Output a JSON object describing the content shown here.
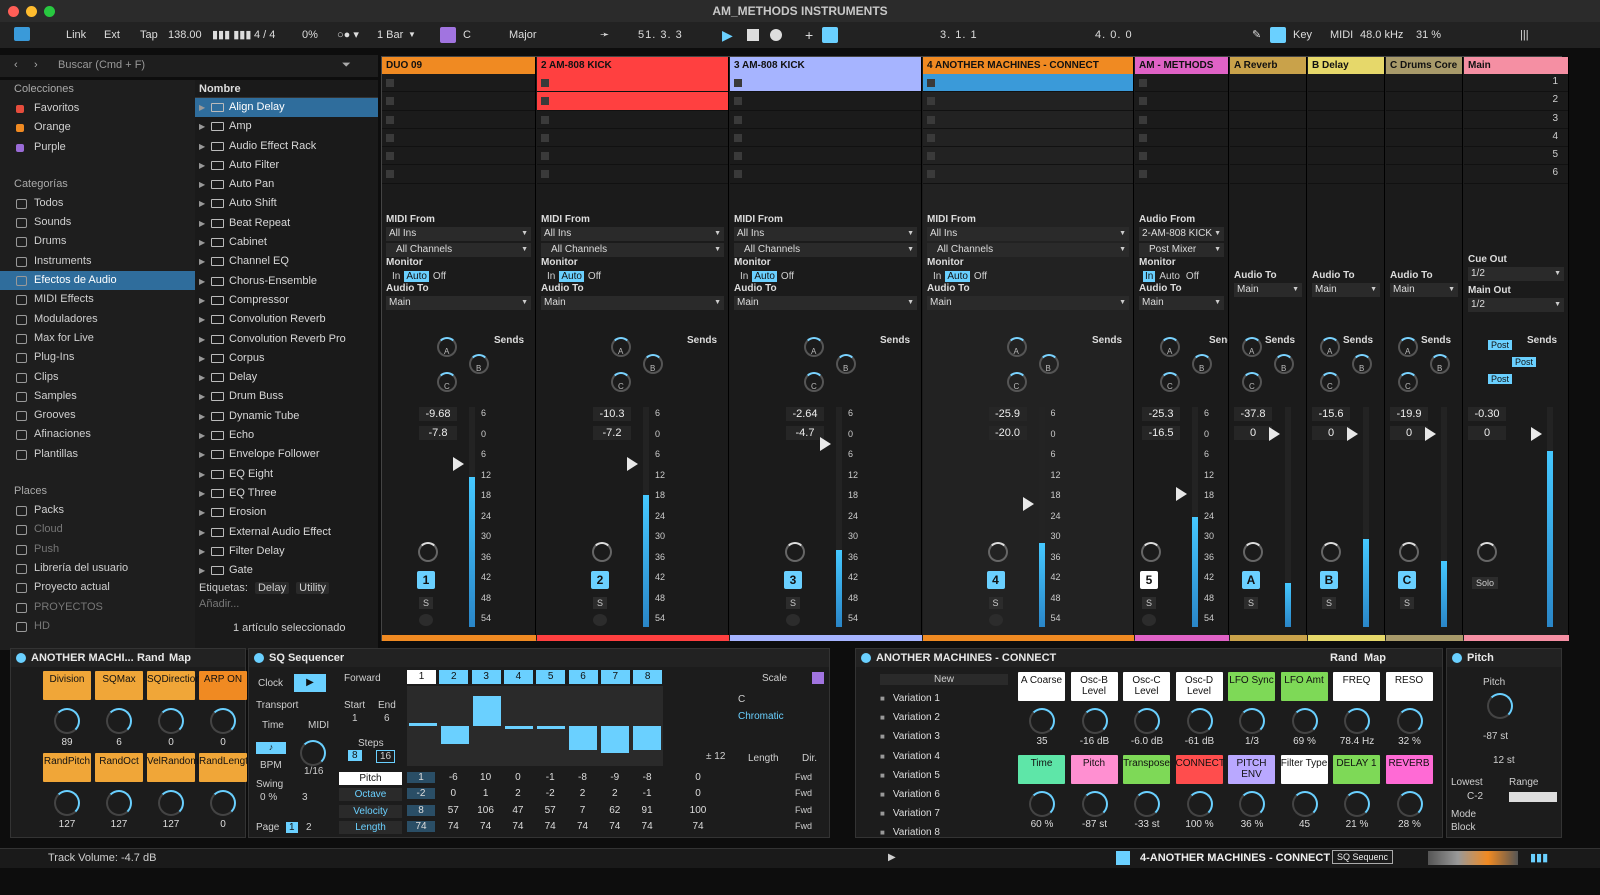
{
  "window": {
    "title": "AM_METHODS INSTRUMENTS"
  },
  "toolbar": {
    "link": "Link",
    "ext": "Ext",
    "tap": "Tap",
    "tempo": "138.00",
    "meter": "4 / 4",
    "swing_pct": "0%",
    "quantize": "1 Bar",
    "key_root": "C",
    "scale": "Major",
    "position": "51. 3. 3",
    "loop_start": "3. 1. 1",
    "loop_len": "4. 0. 0",
    "key": "Key",
    "midi": "MIDI",
    "sample_rate": "48.0 kHz",
    "cpu": "31 %"
  },
  "browser": {
    "search_placeholder": "Buscar (Cmd + F)",
    "collections_title": "Colecciones",
    "collections": [
      "Favoritos",
      "Orange",
      "Purple"
    ],
    "collection_colors": [
      "#e64d3d",
      "#f08a22",
      "#9a6bd6"
    ],
    "categories_title": "Categorías",
    "categories": [
      "Todos",
      "Sounds",
      "Drums",
      "Instruments",
      "Efectos de Audio",
      "MIDI Effects",
      "Moduladores",
      "Max for Live",
      "Plug-Ins",
      "Clips",
      "Samples",
      "Grooves",
      "Afinaciones",
      "Plantillas"
    ],
    "places_title": "Places",
    "places": [
      "Packs",
      "Cloud",
      "Push",
      "Librería del usuario",
      "Proyecto actual",
      "PROYECTOS",
      "HD"
    ],
    "list_header": "Nombre",
    "items": [
      "Align Delay",
      "Amp",
      "Audio Effect Rack",
      "Auto Filter",
      "Auto Pan",
      "Auto Shift",
      "Beat Repeat",
      "Cabinet",
      "Channel EQ",
      "Chorus-Ensemble",
      "Compressor",
      "Convolution Reverb",
      "Convolution Reverb Pro",
      "Corpus",
      "Delay",
      "Drum Buss",
      "Dynamic Tube",
      "Echo",
      "Envelope Follower",
      "EQ Eight",
      "EQ Three",
      "Erosion",
      "External Audio Effect",
      "Filter Delay",
      "Gate"
    ],
    "tags_label": "Etiquetas:",
    "tags": [
      "Delay",
      "Utility"
    ],
    "add_label": "Añadir...",
    "selected_info": "1 artículo seleccionado"
  },
  "tracks": [
    {
      "name": "DUO 09",
      "color": "#f08a22",
      "from_label": "MIDI From",
      "from": "All Ins",
      "channel": "All Channels",
      "monitor": [
        "In",
        "Auto",
        "Off"
      ],
      "to_label": "Audio To",
      "to": "Main",
      "vol": "-9.68",
      "peak": "-7.8",
      "num": "1",
      "meter": 0.68
    },
    {
      "name": "2 AM-808 KICK",
      "color": "#ff4040",
      "from_label": "MIDI From",
      "from": "All Ins",
      "channel": "All Channels",
      "monitor": [
        "In",
        "Auto",
        "Off"
      ],
      "to_label": "Audio To",
      "to": "Main",
      "vol": "-10.3",
      "peak": "-7.2",
      "num": "2",
      "meter": 0.6
    },
    {
      "name": "3 AM-808 KICK",
      "color": "#a6b4ff",
      "from_label": "MIDI From",
      "from": "All Ins",
      "channel": "All Channels",
      "monitor": [
        "In",
        "Auto",
        "Off"
      ],
      "to_label": "Audio To",
      "to": "Main",
      "vol": "-2.64",
      "peak": "-4.7",
      "num": "3",
      "meter": 0.35
    },
    {
      "name": "4 ANOTHER MACHINES - CONNECT",
      "color": "#f08a22",
      "from_label": "MIDI From",
      "from": "All Ins",
      "channel": "All Channels",
      "monitor": [
        "In",
        "Auto",
        "Off"
      ],
      "to_label": "Audio To",
      "to": "Main",
      "vol": "-25.9",
      "peak": "-20.0",
      "num": "4",
      "meter": 0.38
    },
    {
      "name": "AM - METHODS",
      "color": "#e062c6",
      "from_label": "Audio From",
      "from": "2-AM-808 KICK",
      "channel": "Post Mixer",
      "monitor": [
        "In",
        "Auto",
        "Off"
      ],
      "to_label": "Audio To",
      "to": "Main",
      "vol": "-25.3",
      "peak": "-16.5",
      "num": "5",
      "meter": 0.5
    },
    {
      "name": "A Reverb",
      "color": "#c9a24a",
      "to_label": "Audio To",
      "to": "Main",
      "vol": "-37.8",
      "peak": "0",
      "num": "A",
      "meter": 0.2
    },
    {
      "name": "B Delay",
      "color": "#e6d86a",
      "to_label": "Audio To",
      "to": "Main",
      "vol": "-15.6",
      "peak": "0",
      "num": "B",
      "meter": 0.4
    },
    {
      "name": "C Drums Core",
      "color": "#a89a6a",
      "to_label": "Audio To",
      "to": "Main",
      "vol": "-19.9",
      "peak": "0",
      "num": "C",
      "meter": 0.3
    },
    {
      "name": "Main",
      "color": "#f58fa3",
      "cue_label": "Cue Out",
      "cue": "1/2",
      "main_label": "Main Out",
      "main": "1/2",
      "vol": "-0.30",
      "peak": "0",
      "solo": "Solo",
      "meter": 0.8
    }
  ],
  "scene_numbers": [
    "1",
    "2",
    "3",
    "4",
    "5",
    "6"
  ],
  "sends_label": "Sends",
  "send_labels": [
    "A",
    "B",
    "C"
  ],
  "post_label": "Post",
  "solo_label": "S",
  "meter_scale": [
    "6",
    "0",
    "6",
    "12",
    "18",
    "24",
    "30",
    "36",
    "42",
    "48",
    "54",
    "60"
  ],
  "devices": {
    "am": {
      "title": "ANOTHER MACHI...",
      "rand": "Rand",
      "map": "Map",
      "buttons": [
        "Division",
        "SQMax",
        "SQDirection",
        "ARP ON",
        "RandPitch",
        "RandOct",
        "VelRandom",
        "RandLength"
      ],
      "values": [
        "89",
        "6",
        "0",
        "0",
        "127",
        "127",
        "127",
        "0"
      ]
    },
    "sq": {
      "title": "SQ Sequencer",
      "direction": "Forward",
      "clock": "Clock",
      "transport": "Transport",
      "time": "Time",
      "midi": "MIDI",
      "bpm": "BPM",
      "rate": "1/16",
      "swing_label": "Swing",
      "swing": "0 %",
      "swing_val": "3",
      "start_label": "Start",
      "end_label": "End",
      "start": "1",
      "end": "6",
      "steps_label": "Steps",
      "steps": [
        "8",
        "16"
      ],
      "step_nums": [
        "1",
        "2",
        "3",
        "4",
        "5",
        "6",
        "7",
        "8"
      ],
      "page_label": "Page",
      "pages": [
        "1",
        "2"
      ],
      "scale_label": "Scale",
      "scale_root": "C",
      "scale_type": "Chromatic",
      "transpose": "± 12",
      "length_label": "Length",
      "dir_label": "Dir.",
      "rows": [
        {
          "label": "Pitch",
          "values": [
            "1",
            "-6",
            "10",
            "0",
            "-1",
            "-8",
            "-9",
            "-8"
          ],
          "extra": "0"
        },
        {
          "label": "Octave",
          "values": [
            "-2",
            "0",
            "1",
            "2",
            "-2",
            "2",
            "2",
            "-1"
          ],
          "extra": "0"
        },
        {
          "label": "Velocity",
          "values": [
            "8",
            "57",
            "106",
            "47",
            "57",
            "7",
            "62",
            "91"
          ],
          "extra": "100"
        },
        {
          "label": "Length",
          "values": [
            "74",
            "74",
            "74",
            "74",
            "74",
            "74",
            "74",
            "74"
          ],
          "extra": "74"
        }
      ],
      "fwd": "Fwd"
    },
    "connect": {
      "title": "ANOTHER MACHINES - CONNECT",
      "rand": "Rand",
      "map": "Map",
      "new": "New",
      "variations": [
        "Variation 1",
        "Variation 2",
        "Variation 3",
        "Variation 4",
        "Variation 5",
        "Variation 6",
        "Variation 7",
        "Variation 8"
      ],
      "top": [
        {
          "l": "A Coarse",
          "c": "#ffffff",
          "v": "35"
        },
        {
          "l": "Osc-B Level",
          "c": "#ffffff",
          "v": "-16 dB"
        },
        {
          "l": "Osc-C Level",
          "c": "#ffffff",
          "v": "-6.0 dB"
        },
        {
          "l": "Osc-D Level",
          "c": "#ffffff",
          "v": "-61 dB"
        },
        {
          "l": "LFO Sync",
          "c": "#7ed957",
          "v": "1/3"
        },
        {
          "l": "LFO Amt",
          "c": "#7ed957",
          "v": "69 %"
        },
        {
          "l": "FREQ",
          "c": "#ffffff",
          "v": "78.4 Hz"
        },
        {
          "l": "RESO",
          "c": "#ffffff",
          "v": "32 %"
        }
      ],
      "bottom": [
        {
          "l": "Time",
          "c": "#5ee6a8",
          "v": "60 %"
        },
        {
          "l": "Pitch",
          "c": "#ff8fd1",
          "v": "-87 st"
        },
        {
          "l": "Transpose",
          "c": "#7ed957",
          "v": "-33 st"
        },
        {
          "l": "CONNECT",
          "c": "#ff4d4d",
          "v": "100 %"
        },
        {
          "l": "PITCH ENV",
          "c": "#b9a8ff",
          "v": "36 %"
        },
        {
          "l": "Filter Type",
          "c": "#ffffff",
          "v": "45"
        },
        {
          "l": "DELAY 1",
          "c": "#7ed957",
          "v": "21 %"
        },
        {
          "l": "REVERB",
          "c": "#ff6ad5",
          "v": "28 %"
        }
      ]
    },
    "pitch": {
      "title": "Pitch",
      "label": "Pitch",
      "value": "-87 st",
      "range_st": "12 st",
      "lowest_label": "Lowest",
      "lowest": "C-2",
      "range_label": "Range",
      "mode_label": "Mode",
      "mode": "Block"
    }
  },
  "status": {
    "text": "Track Volume: -4.7 dB",
    "selected_track": "4-ANOTHER MACHINES - CONNECT",
    "device_tab": "SQ Sequenc"
  }
}
